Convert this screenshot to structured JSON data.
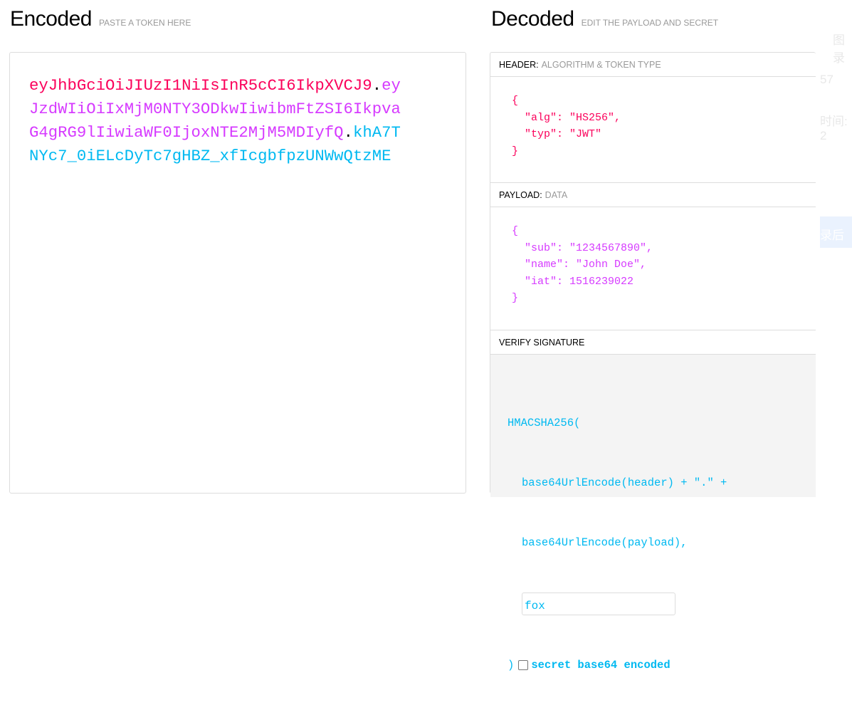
{
  "encoded": {
    "title": "Encoded",
    "subtitle": "PASTE A TOKEN HERE",
    "lines": [
      [
        {
          "t": "eyJhbGciOiJIUzI1NiIsInR5cCI6IkpXVCJ9",
          "c": "h"
        },
        {
          "t": ".",
          "c": "d"
        },
        {
          "t": "ey",
          "c": "p"
        }
      ],
      [
        {
          "t": "JzdWIiOiIxMjM0NTY3ODkwIiwibmFtZSI6Ikpva",
          "c": "p"
        }
      ],
      [
        {
          "t": "G4gRG9lIiwiaWF0IjoxNTE2MjM5MDIyfQ",
          "c": "p"
        },
        {
          "t": ".",
          "c": "d"
        },
        {
          "t": "khA7T",
          "c": "s"
        }
      ],
      [
        {
          "t": "NYc7_0iELcDyTc7gHBZ_xfIcgbfpzUNWwQtzME",
          "c": "s"
        }
      ]
    ]
  },
  "decoded": {
    "title": "Decoded",
    "subtitle": "EDIT THE PAYLOAD AND SECRET",
    "header": {
      "label": "HEADER:",
      "desc": "ALGORITHM & TOKEN TYPE",
      "json": "{\n  \"alg\": \"HS256\",\n  \"typ\": \"JWT\"\n}"
    },
    "payload": {
      "label": "PAYLOAD:",
      "desc": "DATA",
      "json": "{\n  \"sub\": \"1234567890\",\n  \"name\": \"John Doe\",\n  \"iat\": 1516239022\n}"
    },
    "signature": {
      "label": "VERIFY SIGNATURE",
      "fn": "HMACSHA256(",
      "line1": "base64UrlEncode(header) + \".\" +",
      "line2": "base64UrlEncode(payload),",
      "secret": "fox",
      "close": ")",
      "checkbox_label": "secret base64 encoded",
      "checked": false
    }
  },
  "background_ghost": {
    "a": "图录",
    "b": "57",
    "c": "时间: 2",
    "d": "录后"
  },
  "colors": {
    "header": "#fb015b",
    "payload": "#d63aff",
    "signature": "#00b9f1"
  }
}
